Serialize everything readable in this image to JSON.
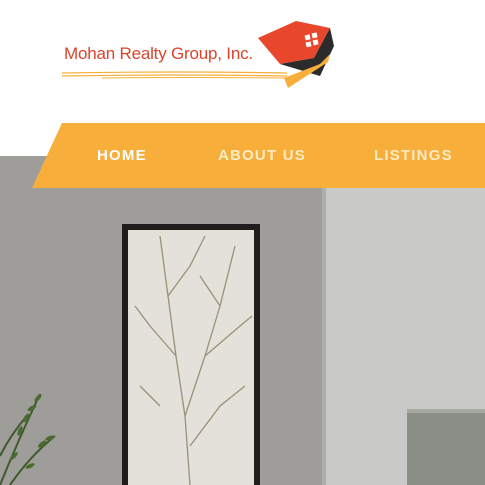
{
  "brand": {
    "name": "Mohan Realty Group, Inc.",
    "colors": {
      "text": "#d9442b",
      "roof": "#e8472c",
      "house_dark": "#2b2b2b",
      "accent": "#f7ae3a"
    }
  },
  "nav": {
    "items": [
      {
        "label": "HOME",
        "active": true
      },
      {
        "label": "ABOUT US",
        "active": false
      },
      {
        "label": "LISTINGS",
        "active": false
      }
    ],
    "color": "#f7ae3a"
  },
  "hero": {
    "description_icon": "interior-photo"
  }
}
